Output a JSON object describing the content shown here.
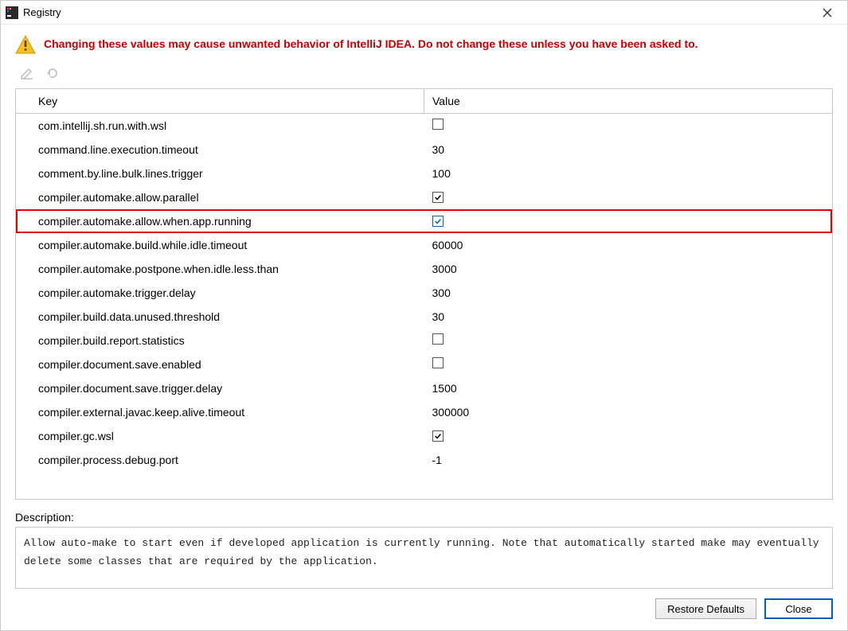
{
  "window": {
    "title": "Registry"
  },
  "warning": {
    "text": "Changing these values may cause unwanted behavior of IntelliJ IDEA. Do not change these unless you have been asked to."
  },
  "toolbar": {
    "edit_tooltip": "Edit",
    "revert_tooltip": "Revert"
  },
  "table": {
    "columns": {
      "key": "Key",
      "value": "Value"
    },
    "rows": [
      {
        "key": "com.intellij.sh.run.with.wsl",
        "value_type": "checkbox",
        "checked": false,
        "highlight": false
      },
      {
        "key": "command.line.execution.timeout",
        "value_type": "text",
        "value": "30",
        "highlight": false
      },
      {
        "key": "comment.by.line.bulk.lines.trigger",
        "value_type": "text",
        "value": "100",
        "highlight": false
      },
      {
        "key": "compiler.automake.allow.parallel",
        "value_type": "checkbox",
        "checked": true,
        "highlight": false
      },
      {
        "key": "compiler.automake.allow.when.app.running",
        "value_type": "checkbox_blue",
        "checked": true,
        "highlight": true
      },
      {
        "key": "compiler.automake.build.while.idle.timeout",
        "value_type": "text",
        "value": "60000",
        "highlight": false
      },
      {
        "key": "compiler.automake.postpone.when.idle.less.than",
        "value_type": "text",
        "value": "3000",
        "highlight": false
      },
      {
        "key": "compiler.automake.trigger.delay",
        "value_type": "text",
        "value": "300",
        "highlight": false
      },
      {
        "key": "compiler.build.data.unused.threshold",
        "value_type": "text",
        "value": "30",
        "highlight": false
      },
      {
        "key": "compiler.build.report.statistics",
        "value_type": "checkbox",
        "checked": false,
        "highlight": false
      },
      {
        "key": "compiler.document.save.enabled",
        "value_type": "checkbox",
        "checked": false,
        "highlight": false
      },
      {
        "key": "compiler.document.save.trigger.delay",
        "value_type": "text",
        "value": "1500",
        "highlight": false
      },
      {
        "key": "compiler.external.javac.keep.alive.timeout",
        "value_type": "text",
        "value": "300000",
        "highlight": false
      },
      {
        "key": "compiler.gc.wsl",
        "value_type": "checkbox",
        "checked": true,
        "highlight": false
      },
      {
        "key": "compiler.process.debug.port",
        "value_type": "text",
        "value": "-1",
        "highlight": false
      }
    ]
  },
  "description": {
    "label": "Description:",
    "text": "Allow auto-make to start even if developed application is currently running. Note that automatically started make may eventually delete some classes that are required by the application."
  },
  "buttons": {
    "restore": "Restore Defaults",
    "close": "Close"
  }
}
